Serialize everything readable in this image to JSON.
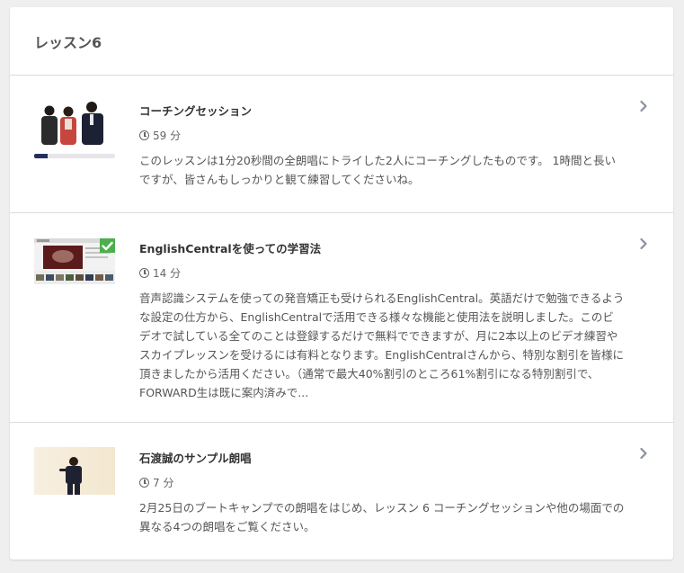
{
  "section": {
    "title": "レッスン6"
  },
  "lessons": [
    {
      "title": "コーチングセッション",
      "duration": "59 分",
      "progress": 0.17,
      "completed": false,
      "description": "このレッスンは1分20秒間の全朗唱にトライした2人にコーチングしたものです。 1時間と長いですが、皆さんもしっかりと観て練習してくださいね。"
    },
    {
      "title": "EnglishCentralを使っての学習法",
      "duration": "14 分",
      "completed": true,
      "description": "音声認識システムを使っての発音矯正も受けられるEnglishCentral。英語だけで勉強できるような設定の仕方から、EnglishCentralで活用できる様々な機能と使用法を説明しました。このビデオで試している全てのことは登録するだけで無料でできますが、月に2本以上のビデオ練習やスカイプレッスンを受けるには有料となります。EnglishCentralさんから、特別な割引を皆様に頂きましたから活用ください。（通常で最大40%割引のところ61%割引になる特別割引で、　FORWARD生は既に案内済みで..."
    },
    {
      "title": "石渡誠のサンプル朗唱",
      "duration": "7 分",
      "completed": false,
      "description": "2月25日のブートキャンプでの朗唱をはじめ、レッスン 6 コーチングセッションや他の場面での異なる4つの朗唱をご覧ください。"
    }
  ],
  "colors": {
    "progress_fill": "#23305e",
    "check": "#4cae4c",
    "chevron": "#8a8fa3"
  },
  "icons": {
    "duration": "clock-icon",
    "open": "chevron-right-icon",
    "completed": "checkmark-icon"
  }
}
